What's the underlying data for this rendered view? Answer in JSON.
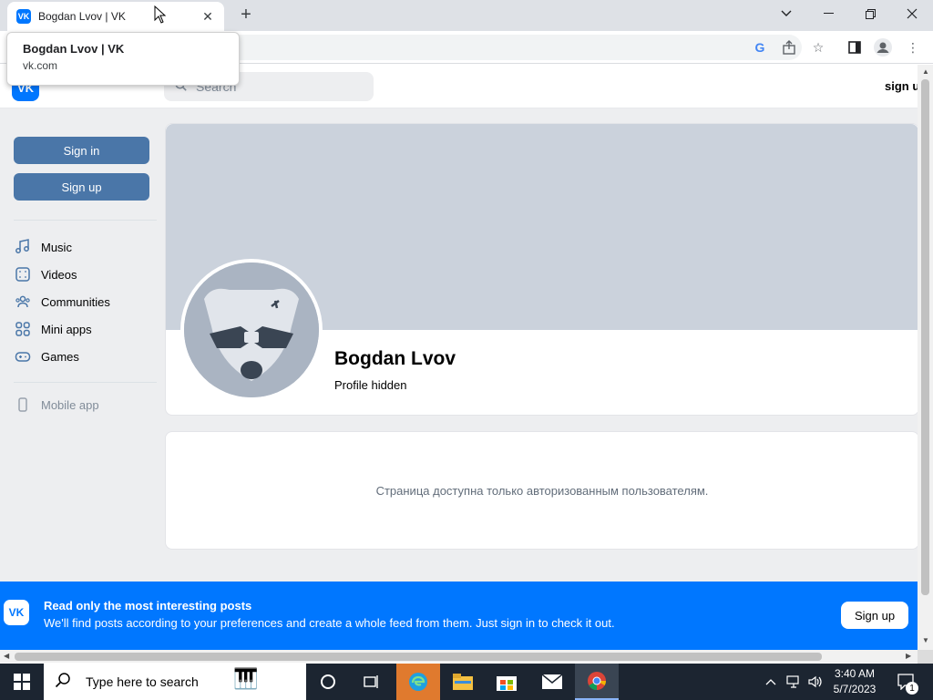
{
  "browser": {
    "tab_title": "Bogdan Lvov | VK",
    "tab_favicon": "VK",
    "tooltip_title": "Bogdan Lvov | VK",
    "tooltip_url": "vk.com"
  },
  "vk": {
    "logo": "VK",
    "search_placeholder": "Search",
    "header_signup": "sign up",
    "sign_in_label": "Sign in",
    "sign_up_label": "Sign up",
    "nav": [
      {
        "label": "Music",
        "icon": "music-icon"
      },
      {
        "label": "Videos",
        "icon": "video-icon"
      },
      {
        "label": "Communities",
        "icon": "users-icon"
      },
      {
        "label": "Mini apps",
        "icon": "apps-icon"
      },
      {
        "label": "Games",
        "icon": "gamepad-icon"
      }
    ],
    "mobile_app": "Mobile app",
    "profile_name": "Bogdan Lvov",
    "profile_status": "Profile hidden",
    "notice": "Страница доступна только авторизованным пользователям."
  },
  "banner": {
    "logo": "VK",
    "title": "Read only the most interesting posts",
    "text": "We'll find posts according to your preferences and create a whole feed from them. Just sign in to check it out.",
    "button": "Sign up"
  },
  "taskbar": {
    "search_placeholder": "Type here to search",
    "time": "3:40 AM",
    "date": "5/7/2023",
    "notification_count": "1"
  },
  "colors": {
    "vk_blue": "#0077ff",
    "button_blue": "#4a76a8",
    "page_bg": "#edeef0"
  }
}
